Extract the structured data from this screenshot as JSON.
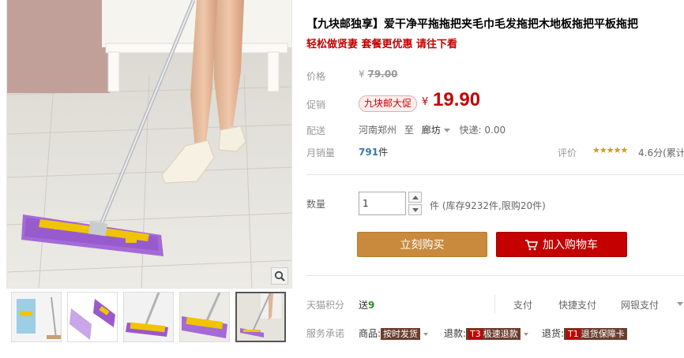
{
  "product": {
    "title": "【九块邮独享】爱干净平拖拖把夹毛巾毛发拖把木地板拖把平板拖把",
    "subtitle": "轻松做贤妻 套餐更优惠 请往下看"
  },
  "price": {
    "label": "价格",
    "currency": "¥",
    "original": "79.00"
  },
  "promotion": {
    "label": "促销",
    "badge": "九块邮大促",
    "currency": "¥",
    "price": "19.90"
  },
  "shipping": {
    "label": "配送",
    "from": "河南郑州",
    "to_word": "至",
    "destination": "廊坊",
    "express": "快递: 0.00"
  },
  "sales": {
    "label": "月销量",
    "count": "791",
    "unit": "件"
  },
  "rating": {
    "label": "评价",
    "stars": "★★★★★",
    "score": "4.6分(累计"
  },
  "quantity": {
    "label": "数量",
    "value": "1",
    "unit_stock": "件 (库存9232件,限购20件)"
  },
  "buttons": {
    "buy_now": "立刻购买",
    "add_to_cart": "加入购物车"
  },
  "points": {
    "label": "天猫积分",
    "prefix": "送",
    "value": "9"
  },
  "payment": {
    "label": "支付",
    "quick": "快捷支付",
    "bank": "网银支付"
  },
  "services": {
    "label": "服务承诺",
    "goods_label": "商品:",
    "goods_tag": "按时发货",
    "refund_label": "退款:",
    "refund_code": "T3",
    "refund_tag": "极速退款",
    "return_label": "退货:",
    "return_code": "T1",
    "return_tag": "退货保障卡"
  },
  "colors": {
    "accent_red": "#c40000",
    "buy_button": "#c98a3d",
    "sales_blue": "#3c78a9",
    "mop_purple": "#9b59c9",
    "mop_yellow": "#f2c400"
  },
  "icons": [
    "zoom-icon",
    "cart-icon",
    "spinner-up-icon",
    "spinner-down-icon",
    "dropdown-arrow-icon"
  ]
}
